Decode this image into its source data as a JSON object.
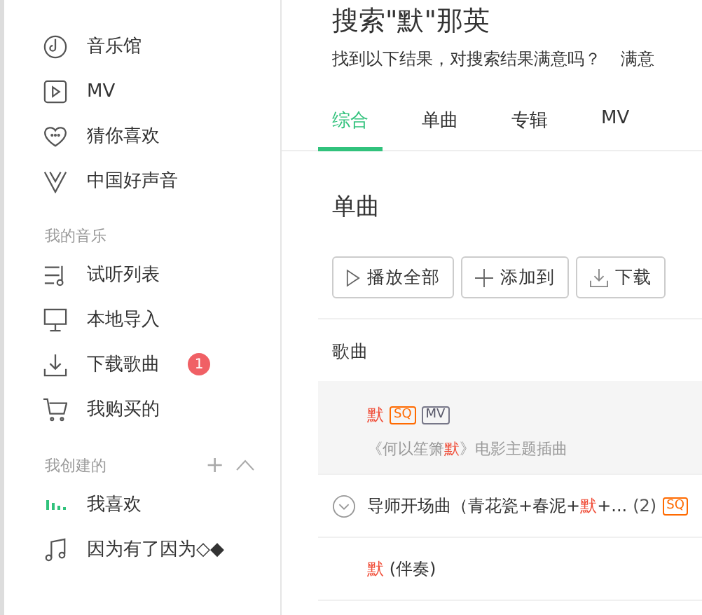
{
  "sidebar": {
    "items": [
      {
        "label": "音乐馆"
      },
      {
        "label": "MV"
      },
      {
        "label": "猜你喜欢"
      },
      {
        "label": "中国好声音"
      }
    ],
    "sections": [
      {
        "title": "我的音乐",
        "items": [
          {
            "label": "试听列表"
          },
          {
            "label": "本地导入"
          },
          {
            "label": "下载歌曲",
            "badge": "1"
          },
          {
            "label": "我购买的"
          }
        ]
      },
      {
        "title": "我创建的",
        "add": "+",
        "items": [
          {
            "label": "我喜欢"
          },
          {
            "label": "因为有了因为◇◆"
          }
        ]
      }
    ]
  },
  "header": {
    "title": "搜索\"默\"那英",
    "subtitle": "找到以下结果，对搜索结果满意吗？",
    "link": "满意"
  },
  "tabs": [
    {
      "label": "综合",
      "selected": true
    },
    {
      "label": "单曲",
      "selected": false
    },
    {
      "label": "专辑",
      "selected": false
    },
    {
      "label": "MV",
      "selected": false
    }
  ],
  "section_title": "单曲",
  "buttons": [
    {
      "label": "播放全部"
    },
    {
      "label": "添加到"
    },
    {
      "label": "下载"
    }
  ],
  "column": "歌曲",
  "songs": [
    {
      "parts": [
        {
          "text": "默",
          "hit": true
        }
      ],
      "tags": [
        "SQ",
        "MV"
      ],
      "subtitle": [
        {
          "text": "《何以笙箫",
          "hit": false
        },
        {
          "text": "默",
          "hit": true
        },
        {
          "text": "》电影主题插曲",
          "hit": false
        }
      ],
      "hovered": true,
      "expand": false
    },
    {
      "parts": [
        {
          "text": "导师开场曲（青花瓷+春泥+",
          "hit": false
        },
        {
          "text": "默",
          "hit": true
        },
        {
          "text": "+...",
          "hit": false
        }
      ],
      "count": "(2)",
      "tags": [
        "SQ"
      ],
      "hovered": false,
      "expand": true
    },
    {
      "parts": [
        {
          "text": "默",
          "hit": true
        },
        {
          "text": " (伴奏)",
          "hit": false
        }
      ],
      "hovered": false,
      "expand": false
    }
  ]
}
